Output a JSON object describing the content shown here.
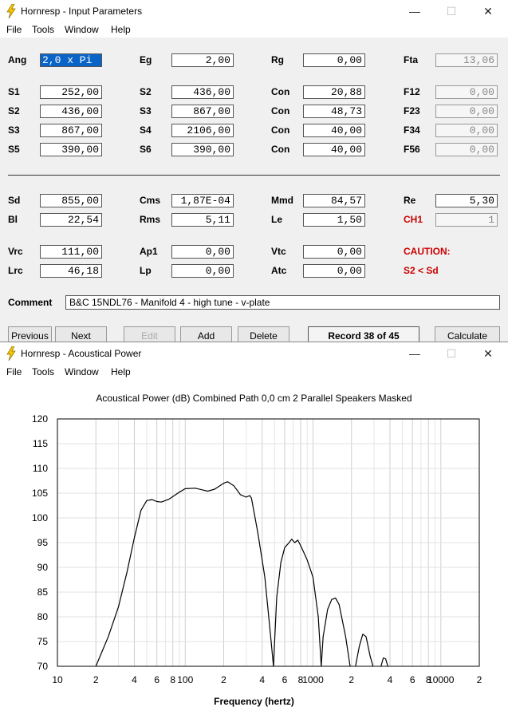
{
  "window1": {
    "title": "Hornresp - Input Parameters",
    "menu": [
      "File",
      "Tools",
      "Window",
      "Help"
    ],
    "rows": [
      [
        [
          "Ang",
          "2,0 x Pi"
        ],
        [
          "Eg",
          "2,00"
        ],
        [
          "Rg",
          "0,00"
        ],
        [
          "Fta",
          "13,06"
        ]
      ],
      [
        [
          "S1",
          "252,00"
        ],
        [
          "S2",
          "436,00"
        ],
        [
          "Con",
          "20,88"
        ],
        [
          "F12",
          "0,00"
        ]
      ],
      [
        [
          "S2",
          "436,00"
        ],
        [
          "S3",
          "867,00"
        ],
        [
          "Con",
          "48,73"
        ],
        [
          "F23",
          "0,00"
        ]
      ],
      [
        [
          "S3",
          "867,00"
        ],
        [
          "S4",
          "2106,00"
        ],
        [
          "Con",
          "40,00"
        ],
        [
          "F34",
          "0,00"
        ]
      ],
      [
        [
          "S5",
          "390,00"
        ],
        [
          "S6",
          "390,00"
        ],
        [
          "Con",
          "40,00"
        ],
        [
          "F56",
          "0,00"
        ]
      ],
      [
        [
          "Sd",
          "855,00"
        ],
        [
          "Cms",
          "1,87E-04"
        ],
        [
          "Mmd",
          "84,57"
        ],
        [
          "Re",
          "5,30"
        ]
      ],
      [
        [
          "Bl",
          "22,54"
        ],
        [
          "Rms",
          "5,11"
        ],
        [
          "Le",
          "1,50"
        ],
        [
          "CH1",
          "1"
        ]
      ],
      [
        [
          "Vrc",
          "111,00"
        ],
        [
          "Ap1",
          "0,00"
        ],
        [
          "Vtc",
          "0,00"
        ],
        [
          "CAUTION:",
          ""
        ]
      ],
      [
        [
          "Lrc",
          "46,18"
        ],
        [
          "Lp",
          "0,00"
        ],
        [
          "Atc",
          "0,00"
        ],
        [
          "S2 < Sd",
          ""
        ]
      ]
    ],
    "comment_label": "Comment",
    "comment": "B&C 15NDL76 - Manifold 4 - high tune - v-plate",
    "buttons": [
      "Previous",
      "Next",
      "Edit",
      "Add",
      "Delete",
      "Record 38 of 45",
      "Calculate"
    ]
  },
  "window2": {
    "title": "Hornresp - Acoustical Power",
    "menu": [
      "File",
      "Tools",
      "Window",
      "Help"
    ]
  },
  "chart_data": {
    "type": "line",
    "title": "Acoustical Power (dB)   Combined   Path 0,0 cm   2 Parallel Speakers   Masked",
    "xlabel": "Frequency (hertz)",
    "ylabel": "",
    "xscale": "log",
    "xlim": [
      10,
      20000
    ],
    "ylim": [
      70,
      120
    ],
    "x_tick_labels": [
      "10",
      "2",
      "4",
      "6",
      "8",
      "100",
      "2",
      "4",
      "6",
      "8",
      "1000",
      "2",
      "4",
      "6",
      "8",
      "10000",
      "2"
    ],
    "y_tick_labels": [
      "120",
      "115",
      "110",
      "105",
      "100",
      "95",
      "90",
      "85",
      "80",
      "75",
      "70"
    ],
    "grid": true,
    "series": [
      {
        "segments": [
          [
            [
              20,
              70
            ],
            [
              25,
              76
            ],
            [
              30,
              82
            ],
            [
              35,
              89
            ],
            [
              40,
              96
            ],
            [
              45,
              101.5
            ],
            [
              50,
              103.5
            ],
            [
              55,
              103.7
            ],
            [
              60,
              103.3
            ],
            [
              65,
              103.2
            ],
            [
              75,
              103.8
            ],
            [
              90,
              105.2
            ],
            [
              100,
              105.9
            ],
            [
              120,
              106
            ],
            [
              150,
              105.4
            ],
            [
              170,
              105.8
            ],
            [
              200,
              107
            ],
            [
              215,
              107.3
            ],
            [
              240,
              106.5
            ],
            [
              270,
              104.7
            ],
            [
              300,
              104.2
            ],
            [
              320,
              104.5
            ],
            [
              330,
              104
            ],
            [
              370,
              97
            ],
            [
              420,
              88
            ],
            [
              470,
              75
            ],
            [
              490,
              70
            ]
          ],
          [
            [
              490,
              70
            ],
            [
              520,
              84
            ],
            [
              560,
              91
            ],
            [
              600,
              94
            ],
            [
              650,
              95
            ],
            [
              680,
              95.7
            ],
            [
              720,
              95
            ],
            [
              760,
              95.5
            ],
            [
              800,
              94.4
            ],
            [
              900,
              91.5
            ],
            [
              1000,
              88
            ],
            [
              1100,
              80
            ],
            [
              1160,
              70
            ]
          ],
          [
            [
              1160,
              70
            ],
            [
              1200,
              76
            ],
            [
              1300,
              81.5
            ],
            [
              1400,
              83.5
            ],
            [
              1500,
              83.8
            ],
            [
              1600,
              82.5
            ],
            [
              1800,
              76
            ],
            [
              1950,
              70
            ]
          ],
          [
            [
              2150,
              70
            ],
            [
              2300,
              74
            ],
            [
              2450,
              76.5
            ],
            [
              2600,
              76
            ],
            [
              2800,
              72
            ],
            [
              2950,
              70
            ]
          ],
          [
            [
              3400,
              70
            ],
            [
              3550,
              71.7
            ],
            [
              3700,
              71.5
            ],
            [
              3850,
              70
            ]
          ]
        ]
      }
    ]
  }
}
